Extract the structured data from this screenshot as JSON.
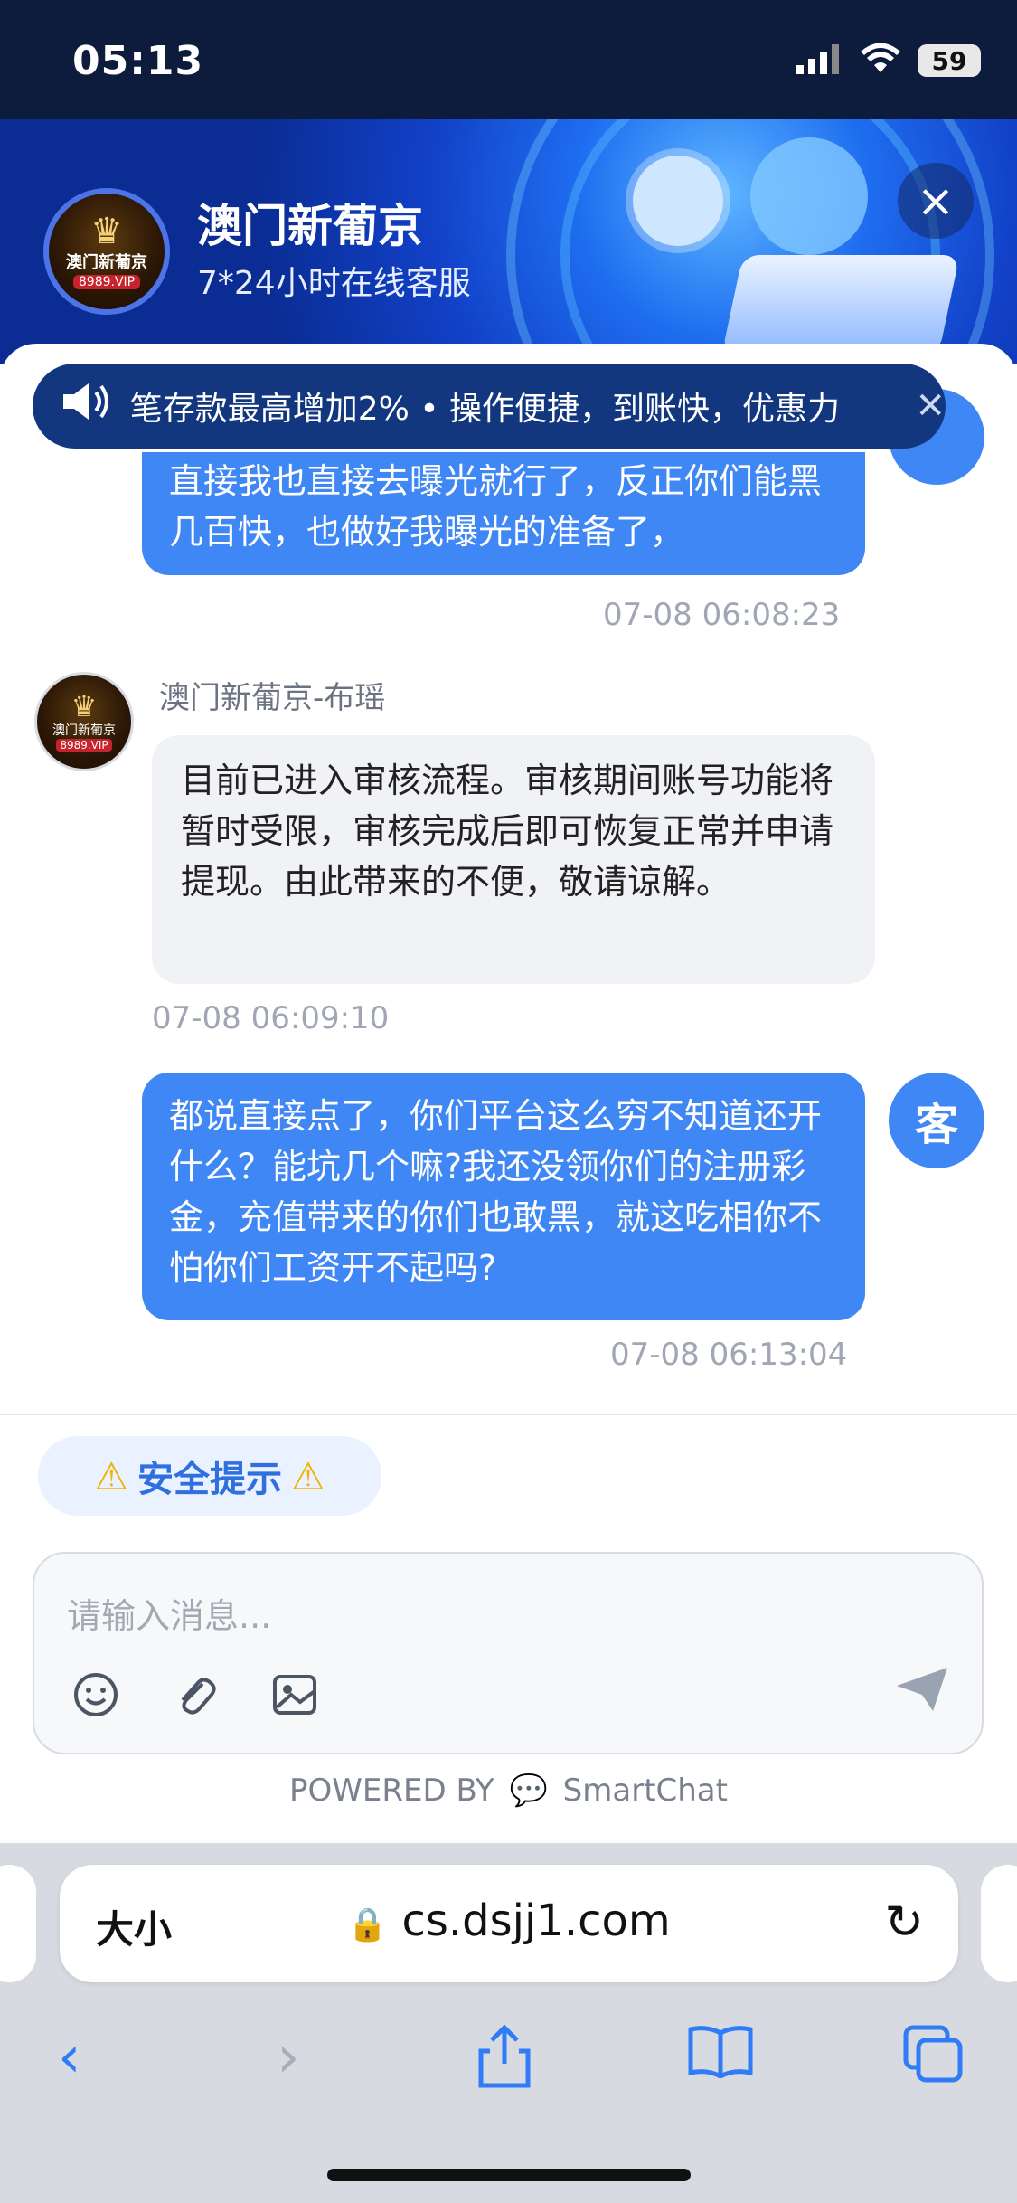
{
  "status": {
    "time": "05:13",
    "battery": "59"
  },
  "header": {
    "logo_name": "澳门新葡京",
    "logo_vip": "8989.VIP",
    "title": "澳门新葡京",
    "subtitle": "7*24小时在线客服",
    "close_icon": "close-icon"
  },
  "notice": {
    "text": "笔存款最高增加2% • 操作便捷，到账快，优惠力",
    "speaker_icon": "speaker-icon",
    "close_icon": "close-icon"
  },
  "messages": [
    {
      "side": "right",
      "text": "直接我也直接去曝光就行了，反正你们能黑几百快，也做好我曝光的准备了，",
      "time": "07-08 06:08:23"
    },
    {
      "side": "left",
      "sender": "澳门新葡京-布瑶",
      "text": "目前已进入审核流程。审核期间账号功能将暂时受限，审核完成后即可恢复正常并申请提现。由此带来的不便，敬请谅解。",
      "time": "07-08 06:09:10"
    },
    {
      "side": "right",
      "text": "都说直接点了，你们平台这么穷不知道还开什么？能坑几个嘛?我还没领你们的注册彩金，充值带来的你们也敢黑，就这吃相你不怕你们工资开不起吗?",
      "time": "07-08 06:13:04",
      "avatar": "客"
    }
  ],
  "safety": {
    "label": "安全提示"
  },
  "composer": {
    "placeholder": "请输入消息..."
  },
  "powered": {
    "prefix": "POWERED BY",
    "brand": "SmartChat"
  },
  "browser": {
    "size_label": "大小",
    "url": "cs.dsjj1.com"
  }
}
